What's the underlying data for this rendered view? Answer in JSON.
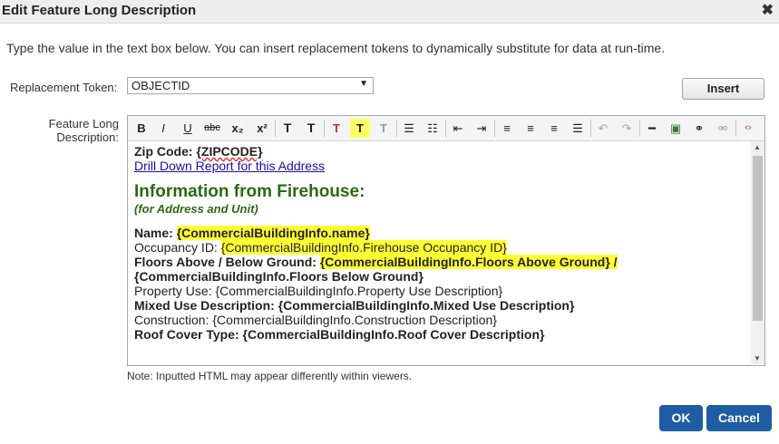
{
  "dialog": {
    "title": "Edit Feature Long Description",
    "close_glyph": "✖",
    "intro": "Type the value in the text box below. You can insert replacement tokens to dynamically substitute for data at run-time.",
    "token_label": "Replacement Token:",
    "token_value": "OBJECTID",
    "insert_label": "Insert",
    "desc_label": "Feature Long Description:",
    "note": "Note: Inputted HTML may appear differently within viewers.",
    "ok_label": "OK",
    "cancel_label": "Cancel"
  },
  "toolbar": {
    "bold": "B",
    "italic": "I",
    "underline": "U",
    "strike": "abc",
    "subscript": "x₂",
    "superscript": "x²",
    "font_size": "T",
    "font_family": "T",
    "text_color": "T",
    "highlight": "T",
    "clear_format": "T"
  },
  "content": {
    "zip_prefix": "Zip Code: ",
    "zip_token": "{ZIPCODE}",
    "link": "Drill Down Report for this Address",
    "heading": "Information from Firehouse:",
    "subheading": "(for Address and Unit)",
    "name_label": "Name: ",
    "name_token": "{CommercialBuildingInfo.name}",
    "occ_label": "Occupancy ID: ",
    "occ_token": "{CommercialBuildingInfo.Firehouse Occupancy ID}",
    "floors_label": "Floors Above / Below Ground: ",
    "floors_token": "{CommercialBuildingInfo.Floors Above Ground} /",
    "floors_line2": "{CommercialBuildingInfo.Floors Below Ground}",
    "prop_line": "Property Use: {CommercialBuildingInfo.Property Use Description}",
    "mixed_line": "Mixed Use Description: {CommercialBuildingInfo.Mixed Use Description}",
    "construction_line": "Construction: {CommercialBuildingInfo.Construction Description}",
    "roof_line": "Roof Cover Type: {CommercialBuildingInfo.Roof Cover Description}"
  },
  "colors": {
    "accent": "#1e5da3",
    "highlight": "#ffff33",
    "heading": "#2b6a14"
  }
}
